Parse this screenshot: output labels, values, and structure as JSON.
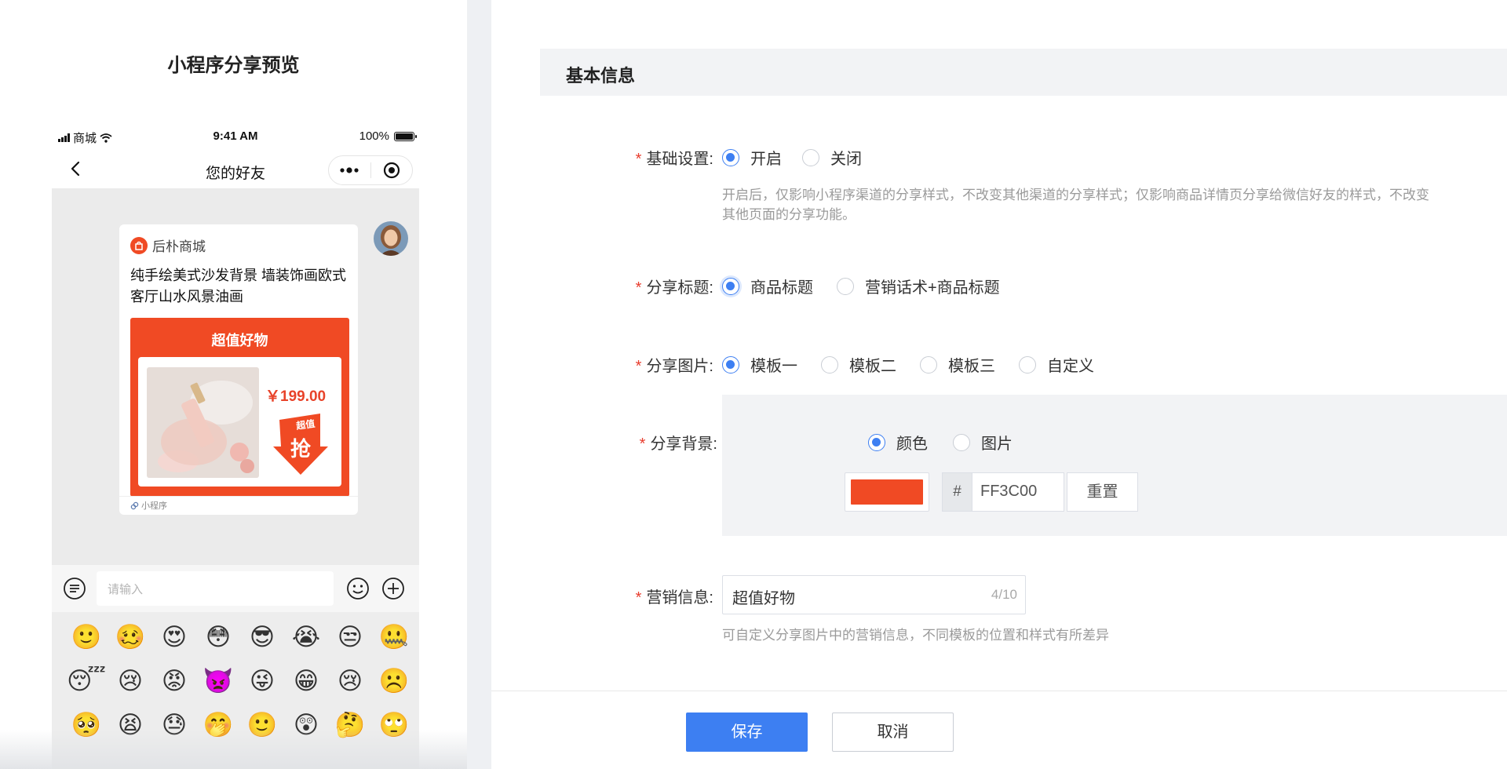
{
  "preview": {
    "title": "小程序分享预览",
    "status": {
      "carrier": "商城",
      "time": "9:41 AM",
      "battery": "100%"
    },
    "nav_title": "您的好友",
    "card": {
      "shop_name": "后朴商城",
      "product_title": "纯手绘美式沙发背景 墙装饰画欧式客厅山水风景油画",
      "poster_title": "超值好物",
      "price": "￥199.00",
      "badge_top": "超值",
      "badge_main": "抢",
      "footer": "小程序"
    },
    "input_placeholder": "请输入",
    "emojis": [
      "🙂",
      "🥴",
      "😍",
      "😳",
      "😎",
      "😭",
      "😒",
      "🤐",
      "😴",
      "😢",
      "😡",
      "👿",
      "😜",
      "😁",
      "😢",
      "☹️",
      "🥺",
      "😫",
      "😓",
      "🤭",
      "🙂",
      "😲",
      "🤔",
      "🙄"
    ]
  },
  "form": {
    "section_title": "基本信息",
    "basic": {
      "label": "基础设置:",
      "options": [
        "开启",
        "关闭"
      ],
      "selected": "开启",
      "hint_line1": "开启后，仅影响小程序渠道的分享样式，不改变其他渠道的分享样式；仅影响商品详情页分享给微信好友的样式，不改变",
      "hint_line2": "其他页面的分享功能。"
    },
    "share_title": {
      "label": "分享标题:",
      "options": [
        "商品标题",
        "营销话术+商品标题"
      ],
      "selected": "商品标题"
    },
    "share_image": {
      "label": "分享图片:",
      "options": [
        "模板一",
        "模板二",
        "模板三",
        "自定义"
      ],
      "selected": "模板一"
    },
    "share_bg": {
      "label": "分享背景:",
      "options": [
        "颜色",
        "图片"
      ],
      "selected": "颜色",
      "color": "#F04A24",
      "hex_prefix": "#",
      "hex_value": "FF3C00",
      "reset_label": "重置"
    },
    "marketing": {
      "label": "营销信息:",
      "value": "超值好物",
      "count": "4/10",
      "hint": "可自定义分享图片中的营销信息，不同模板的位置和样式有所差异"
    },
    "save_label": "保存",
    "cancel_label": "取消"
  }
}
